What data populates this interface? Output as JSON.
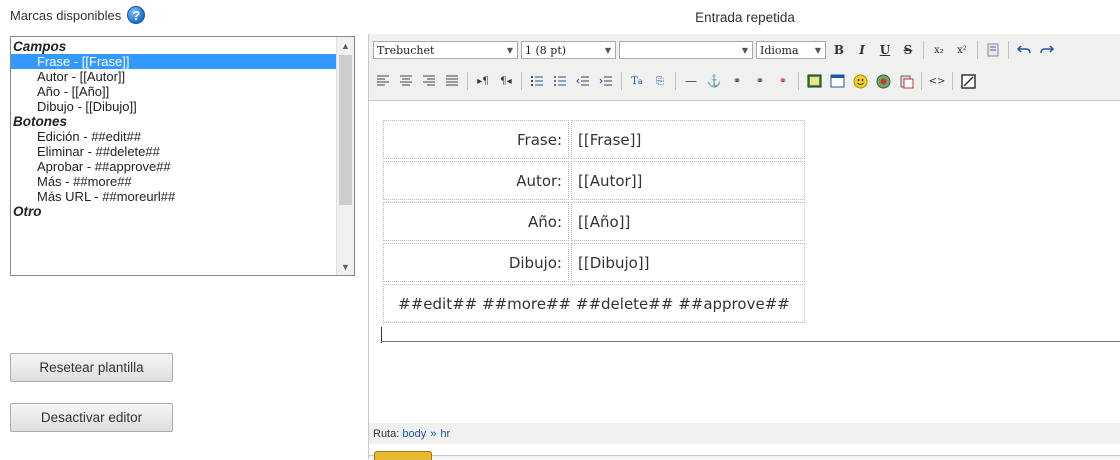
{
  "tags_panel": {
    "title": "Marcas disponibles",
    "groups": [
      {
        "label": "Campos",
        "items": [
          {
            "label": "Frase - [[Frase]]",
            "selected": true
          },
          {
            "label": "Autor - [[Autor]]"
          },
          {
            "label": "Año - [[Año]]"
          },
          {
            "label": "Dibujo - [[Dibujo]]"
          }
        ]
      },
      {
        "label": "Botones",
        "items": [
          {
            "label": "Edición - ##edit##"
          },
          {
            "label": "Eliminar - ##delete##"
          },
          {
            "label": "Aprobar - ##approve##"
          },
          {
            "label": "Más - ##more##"
          },
          {
            "label": "Más URL - ##moreurl##"
          }
        ]
      },
      {
        "label": "Otro",
        "items": []
      }
    ]
  },
  "buttons": {
    "reset": "Resetear plantilla",
    "disable_editor": "Desactivar editor"
  },
  "editor": {
    "title": "Entrada repetida",
    "font_family": "Trebuchet",
    "font_size": "1 (8 pt)",
    "format": "",
    "language": "Idioma",
    "table": [
      {
        "label": "Frase:",
        "value": "[[Frase]]"
      },
      {
        "label": "Autor:",
        "value": "[[Autor]]"
      },
      {
        "label": "Año:",
        "value": "[[Año]]"
      },
      {
        "label": "Dibujo:",
        "value": "[[Dibujo]]"
      }
    ],
    "footer_row": "##edit## ##more## ##delete## ##approve##",
    "path_label": "Ruta:",
    "path": [
      "body",
      "hr"
    ]
  }
}
